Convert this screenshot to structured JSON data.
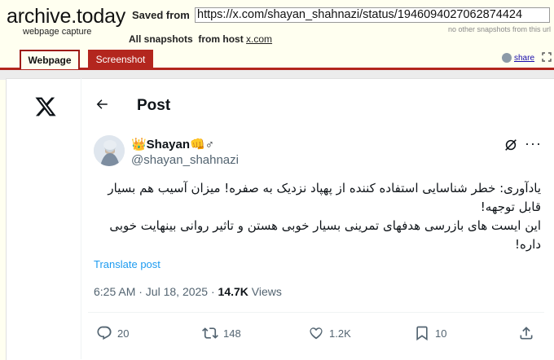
{
  "archive": {
    "logo": "archive.today",
    "logo_sub": "webpage capture",
    "saved_from_label": "Saved from",
    "url": "https://x.com/shayan_shahnazi/status/1946094027062874424",
    "no_other": "no other snapshots from this url",
    "all_snapshots_label": "All snapshots",
    "from_host_label": "from host",
    "host": "x.com",
    "tabs": [
      {
        "label": "Webpage"
      },
      {
        "label": "Screenshot"
      }
    ],
    "share": "share"
  },
  "page": {
    "title": "Post",
    "tweet": {
      "name": "👑Shayan👊♂",
      "handle": "@shayan_shahnazi",
      "text": "یادآوری: خطر شناسایی استفاده کننده از پهپاد نزدیک به صفره! میزان آسیب هم بسیار قابل توجهه!\nاین ایست های بازرسی هدفهای تمرینی بسیار خوبی هستن و تاثیر روانی بینهایت خوبی داره!",
      "translate": "Translate post",
      "time": "6:25 AM · Jul 18, 2025",
      "views_count": "14.7K",
      "views_label": "Views",
      "replies": "20",
      "reposts": "148",
      "likes": "1.2K",
      "bookmarks": "10"
    }
  },
  "colors": {
    "archive_red": "#b3261e",
    "link_blue": "#1d9bf0",
    "text_gray": "#536471"
  }
}
